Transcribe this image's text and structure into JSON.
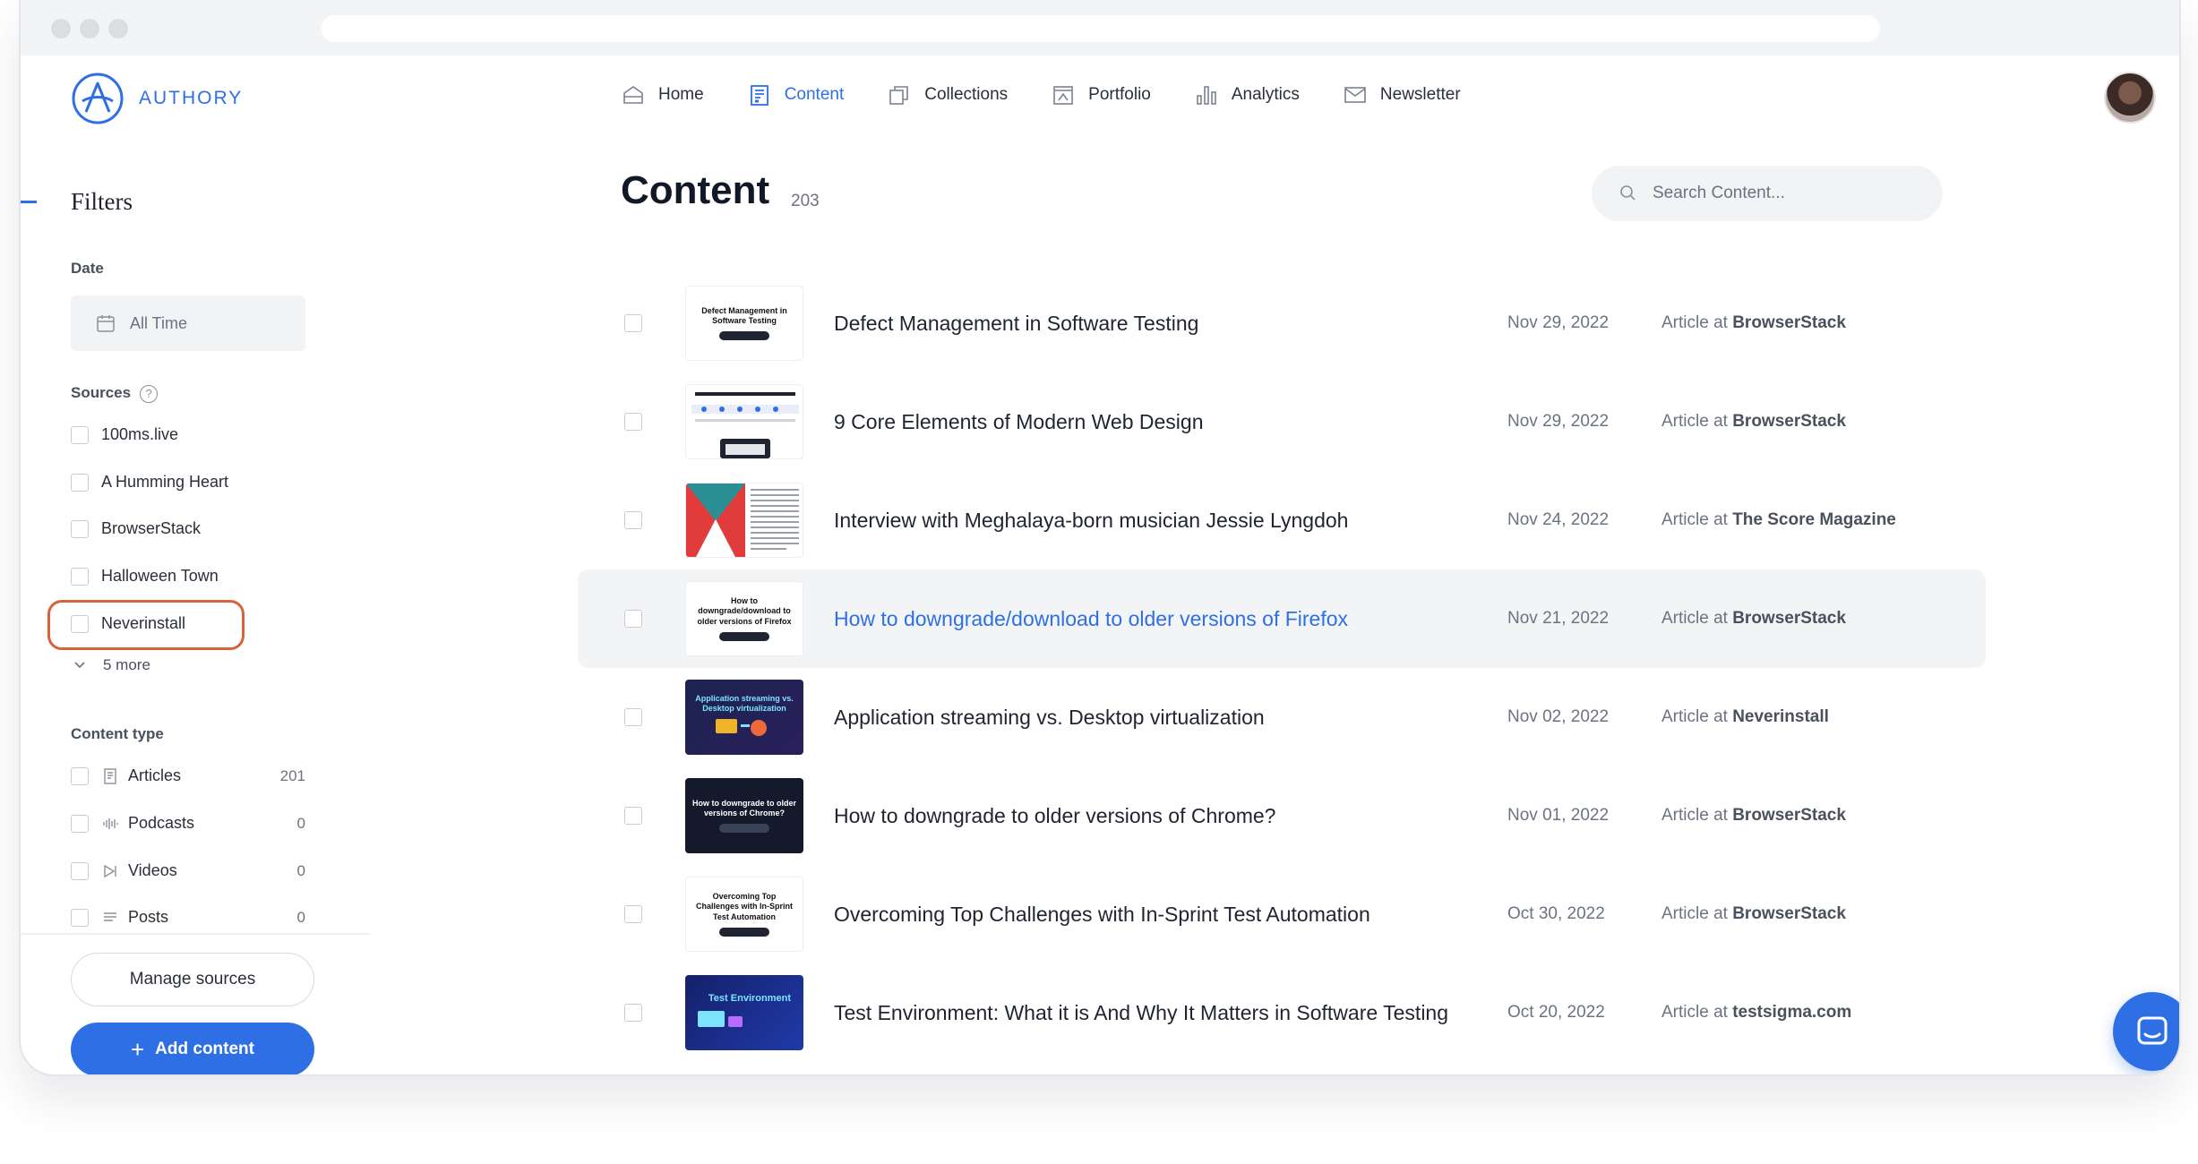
{
  "brand": {
    "name": "AUTHORY"
  },
  "nav": [
    {
      "label": "Home",
      "icon": "home-icon",
      "active": false
    },
    {
      "label": "Content",
      "icon": "content-icon",
      "active": true
    },
    {
      "label": "Collections",
      "icon": "collections-icon",
      "active": false
    },
    {
      "label": "Portfolio",
      "icon": "portfolio-icon",
      "active": false
    },
    {
      "label": "Analytics",
      "icon": "analytics-icon",
      "active": false
    },
    {
      "label": "Newsletter",
      "icon": "newsletter-icon",
      "active": false
    }
  ],
  "sidebar": {
    "title": "Filters",
    "date": {
      "label": "Date",
      "value": "All Time"
    },
    "sources": {
      "label": "Sources",
      "help": "?",
      "items": [
        "100ms.live",
        "A Humming Heart",
        "BrowserStack",
        "Halloween Town",
        "Neverinstall"
      ],
      "more": "5 more"
    },
    "content_type": {
      "label": "Content type",
      "items": [
        {
          "label": "Articles",
          "count": "201",
          "icon": "article-icon"
        },
        {
          "label": "Podcasts",
          "count": "0",
          "icon": "podcast-icon"
        },
        {
          "label": "Videos",
          "count": "0",
          "icon": "video-icon"
        },
        {
          "label": "Posts",
          "count": "0",
          "icon": "posts-icon"
        }
      ]
    },
    "manage_label": "Manage sources",
    "add_label": "Add content",
    "add_plus": "+"
  },
  "main": {
    "title": "Content",
    "count": "203",
    "search_placeholder": "Search Content..."
  },
  "items": [
    {
      "title": "Defect Management in Software Testing",
      "date": "Nov 29, 2022",
      "prefix": "Article at",
      "source": "BrowserStack",
      "thumb_text": "Defect Management in Software Testing"
    },
    {
      "title": "9 Core Elements of Modern Web Design",
      "date": "Nov 29, 2022",
      "prefix": "Article at",
      "source": "BrowserStack",
      "thumb_text": ""
    },
    {
      "title": "Interview with Meghalaya-born musician Jessie Lyngdoh",
      "date": "Nov 24, 2022",
      "prefix": "Article at",
      "source": "The Score Magazine",
      "thumb_text": ""
    },
    {
      "title": "How to downgrade/download to older versions of Firefox",
      "date": "Nov 21, 2022",
      "prefix": "Article at",
      "source": "BrowserStack",
      "thumb_text": "How to downgrade/download to older versions of Firefox"
    },
    {
      "title": "Application streaming vs. Desktop virtualization",
      "date": "Nov 02, 2022",
      "prefix": "Article at",
      "source": "Neverinstall",
      "thumb_text": "Application streaming vs. Desktop virtualization"
    },
    {
      "title": "How to downgrade to older versions of Chrome?",
      "date": "Nov 01, 2022",
      "prefix": "Article at",
      "source": "BrowserStack",
      "thumb_text": "How to downgrade to older versions of Chrome?"
    },
    {
      "title": "Overcoming Top Challenges with In-Sprint Test Automation",
      "date": "Oct 30, 2022",
      "prefix": "Article at",
      "source": "BrowserStack",
      "thumb_text": "Overcoming Top Challenges with In-Sprint Test Automation"
    },
    {
      "title": "Test Environment: What it is And Why It Matters in Software Testing",
      "date": "Oct 20, 2022",
      "prefix": "Article at",
      "source": "testsigma.com",
      "thumb_text": "Test Environment"
    }
  ],
  "colors": {
    "accent": "#2f6fe6",
    "highlight": "#d8623c",
    "hover_row": "#f3f4f6"
  }
}
